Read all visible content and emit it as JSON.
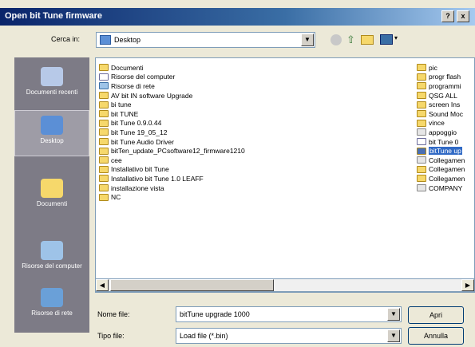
{
  "window": {
    "title": "Open bit Tune firmware",
    "help_label": "?",
    "close_label": "x"
  },
  "lookin": {
    "label": "Cerca in:",
    "value": "Desktop"
  },
  "places": [
    {
      "label": "Documenti recenti",
      "icon": "recent-documents-icon"
    },
    {
      "label": "Desktop",
      "icon": "desktop-icon"
    },
    {
      "label": "Documenti",
      "icon": "my-documents-icon"
    },
    {
      "label": "Risorse del computer",
      "icon": "my-computer-icon"
    },
    {
      "label": "Risorse di rete",
      "icon": "network-places-icon"
    }
  ],
  "files_col1": [
    {
      "name": "Documenti",
      "kind": "folder"
    },
    {
      "name": "Risorse del computer",
      "kind": "file"
    },
    {
      "name": "Risorse di rete",
      "kind": "net"
    },
    {
      "name": "AV bit IN software Upgrade",
      "kind": "folder"
    },
    {
      "name": "bi tune",
      "kind": "folder"
    },
    {
      "name": "bit TUNE",
      "kind": "folder"
    },
    {
      "name": "bit Tune 0.9.0.44",
      "kind": "folder"
    },
    {
      "name": "bit Tune 19_05_12",
      "kind": "folder"
    },
    {
      "name": "bit Tune Audio Driver",
      "kind": "folder"
    },
    {
      "name": "bitTen_update_PCsoftware12_firmware1210",
      "kind": "folder"
    },
    {
      "name": "cee",
      "kind": "folder"
    },
    {
      "name": "Installativo bit Tune",
      "kind": "folder"
    },
    {
      "name": "Installativo bit Tune 1.0 LEAFF",
      "kind": "folder"
    },
    {
      "name": "installazione vista",
      "kind": "folder"
    },
    {
      "name": "NC",
      "kind": "folder"
    }
  ],
  "files_col2": [
    {
      "name": "pic",
      "kind": "folder"
    },
    {
      "name": "progr flash",
      "kind": "folder"
    },
    {
      "name": "programmi",
      "kind": "folder"
    },
    {
      "name": "QSG ALL",
      "kind": "folder"
    },
    {
      "name": "screen Ins",
      "kind": "folder"
    },
    {
      "name": "Sound Moc",
      "kind": "folder"
    },
    {
      "name": "vince",
      "kind": "folder"
    },
    {
      "name": "appoggio",
      "kind": "lnk"
    },
    {
      "name": "bit Tune 0",
      "kind": "file"
    },
    {
      "name": "bitTune up",
      "kind": "sel",
      "selected": true
    },
    {
      "name": "Collegamen",
      "kind": "lnk"
    },
    {
      "name": "Collegamen",
      "kind": "folder"
    },
    {
      "name": "Collegamen",
      "kind": "folder"
    },
    {
      "name": "COMPANY",
      "kind": "lnk"
    }
  ],
  "filename": {
    "label": "Nome file:",
    "value": "bitTune upgrade 1000"
  },
  "filetype": {
    "label": "Tipo file:",
    "value": "Load file (*.bin)"
  },
  "buttons": {
    "open": "Apri",
    "cancel": "Annulla"
  },
  "colors": {
    "selection": "#316ac5",
    "places_bg": "#7d7b86",
    "title_start": "#0a246a"
  }
}
